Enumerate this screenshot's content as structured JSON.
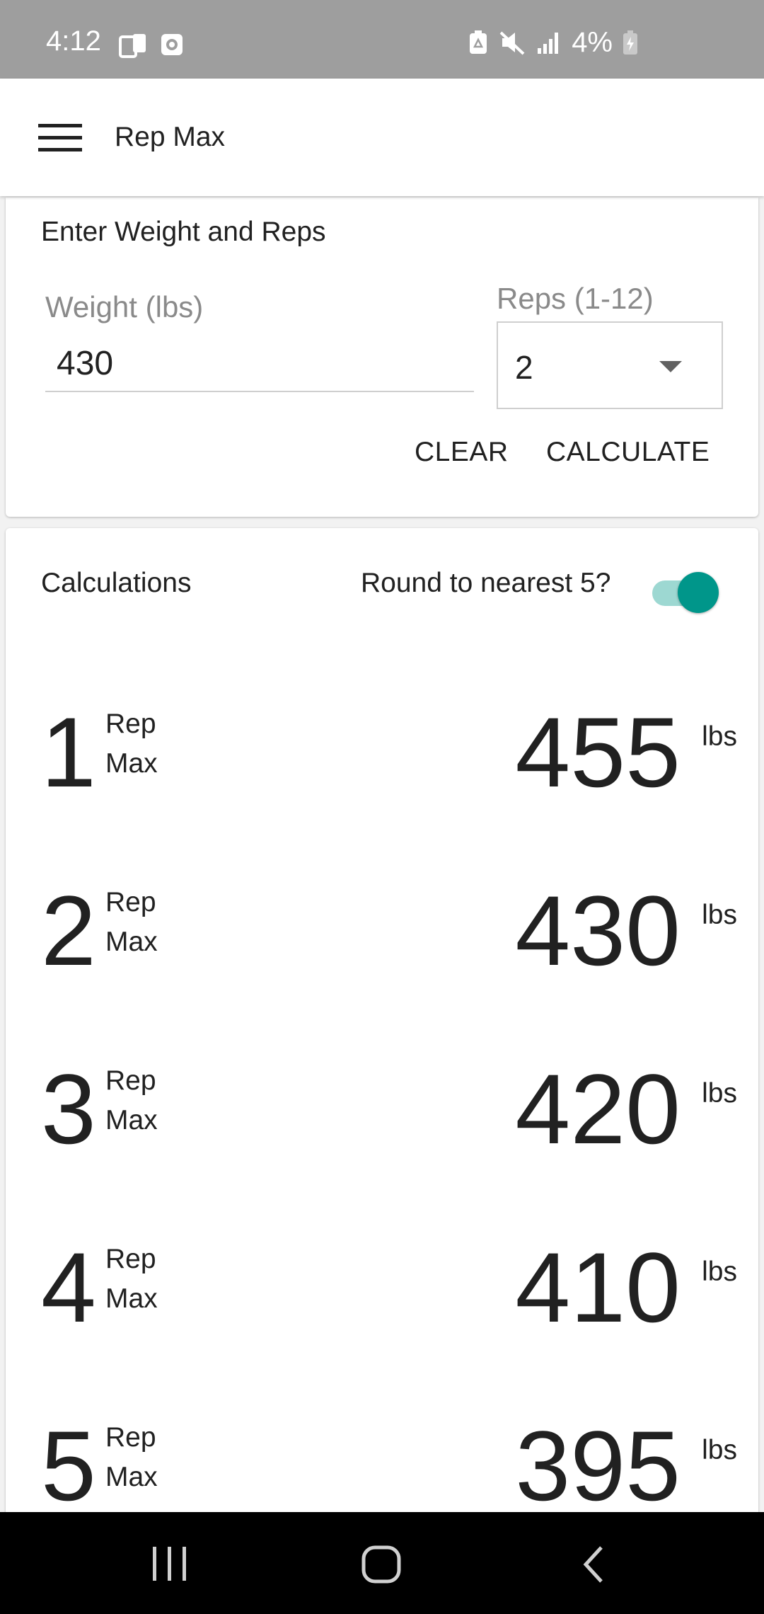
{
  "status_bar": {
    "time": "4:12",
    "battery_percent": "4%",
    "icons_left": [
      "device-transfer-icon",
      "screen-record-icon"
    ],
    "icons_right": [
      "recycle-battery-icon",
      "mute-icon",
      "signal-icon",
      "battery-charging-icon"
    ]
  },
  "app_bar": {
    "title": "Rep Max",
    "menu_icon": "hamburger-menu-icon"
  },
  "input_card": {
    "title": "Enter Weight and Reps",
    "weight_label": "Weight (lbs)",
    "weight_value": "430",
    "reps_label": "Reps (1-12)",
    "reps_value": "2",
    "clear_label": "CLEAR",
    "calculate_label": "CALCULATE"
  },
  "calculations": {
    "title": "Calculations",
    "round_label": "Round to nearest 5?",
    "round_enabled": true,
    "rep_word": "Rep",
    "max_word": "Max",
    "unit": "lbs",
    "rows": [
      {
        "reps": "1",
        "value": "455"
      },
      {
        "reps": "2",
        "value": "430"
      },
      {
        "reps": "3",
        "value": "420"
      },
      {
        "reps": "4",
        "value": "410"
      },
      {
        "reps": "5",
        "value": "395"
      }
    ]
  },
  "colors": {
    "accent": "#00968a",
    "accent_track": "#9dd8d2",
    "status_bar": "#9e9e9e",
    "nav_bar": "#000000"
  },
  "nav_bar": {
    "icons": [
      "recents-icon",
      "home-icon",
      "back-icon"
    ]
  }
}
